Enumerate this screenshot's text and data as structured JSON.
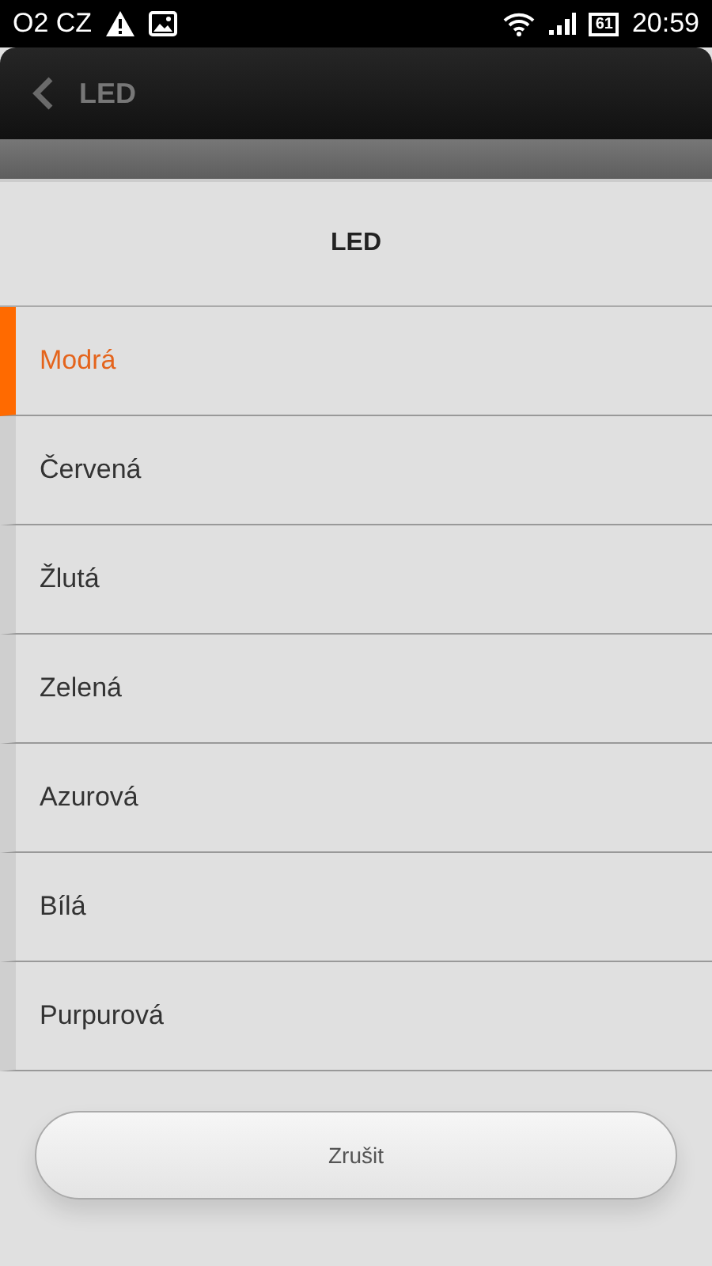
{
  "status_bar": {
    "carrier": "O2 CZ",
    "battery": "61",
    "time": "20:59"
  },
  "header": {
    "title": "LED"
  },
  "dialog": {
    "title": "LED",
    "options": [
      {
        "label": "Modrá",
        "selected": true
      },
      {
        "label": "Červená",
        "selected": false
      },
      {
        "label": "Žlutá",
        "selected": false
      },
      {
        "label": "Zelená",
        "selected": false
      },
      {
        "label": "Azurová",
        "selected": false
      },
      {
        "label": "Bílá",
        "selected": false
      },
      {
        "label": "Purpurová",
        "selected": false
      }
    ],
    "cancel": "Zrušit"
  }
}
